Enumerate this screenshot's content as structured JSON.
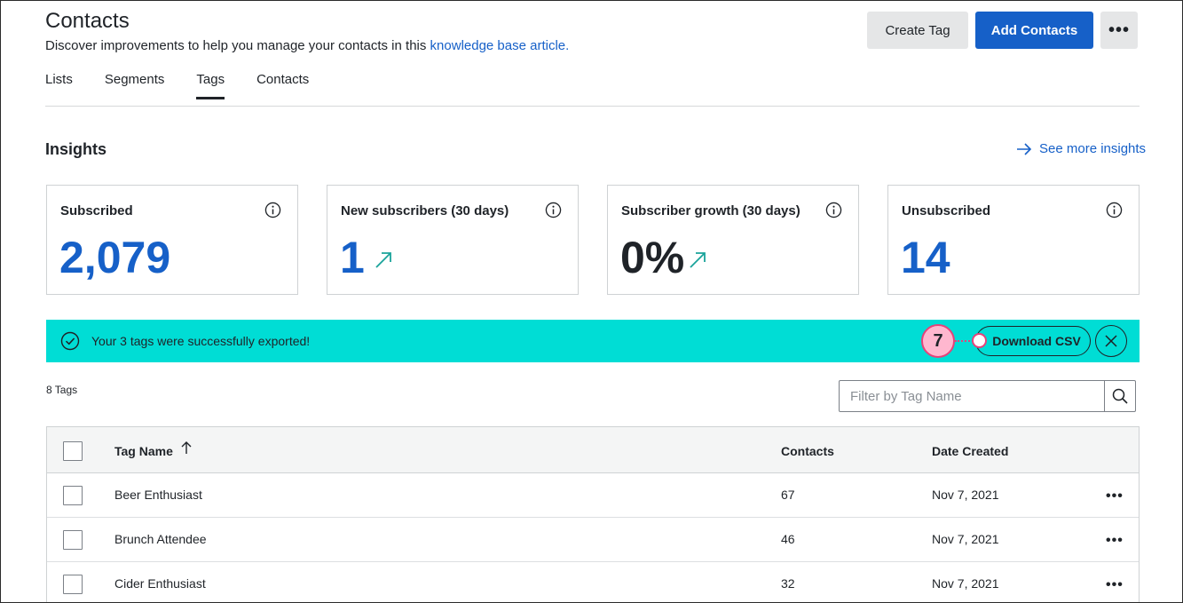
{
  "header": {
    "title": "Contacts",
    "subtitle_text": "Discover improvements to help you manage your contacts in this ",
    "subtitle_link": "knowledge base article.",
    "create_tag_label": "Create Tag",
    "add_contacts_label": "Add Contacts",
    "more_label": "•••"
  },
  "tabs": [
    {
      "label": "Lists",
      "active": false
    },
    {
      "label": "Segments",
      "active": false
    },
    {
      "label": "Tags",
      "active": true
    },
    {
      "label": "Contacts",
      "active": false
    }
  ],
  "insights": {
    "title": "Insights",
    "see_more_label": "See more insights",
    "cards": [
      {
        "title": "Subscribed",
        "value": "2,079",
        "color": "#1660c8",
        "trend": false
      },
      {
        "title": "New subscribers (30 days)",
        "value": "1",
        "color": "#1660c8",
        "trend": true
      },
      {
        "title": "Subscriber growth (30 days)",
        "value": "0%",
        "color": "#1f2328",
        "trend": true
      },
      {
        "title": "Unsubscribed",
        "value": "14",
        "color": "#1660c8",
        "trend": false
      }
    ]
  },
  "banner": {
    "message": "Your 3 tags were successfully exported!",
    "download_label": "Download CSV",
    "step_number": "7",
    "color": "#00ddd5"
  },
  "tags_table": {
    "count_label": "8 Tags",
    "filter_placeholder": "Filter by Tag Name",
    "columns": {
      "name": "Tag Name",
      "contacts": "Contacts",
      "date": "Date Created"
    },
    "rows": [
      {
        "name": "Beer Enthusiast",
        "contacts": "67",
        "date": "Nov 7, 2021"
      },
      {
        "name": "Brunch Attendee",
        "contacts": "46",
        "date": "Nov 7, 2021"
      },
      {
        "name": "Cider Enthusiast",
        "contacts": "32",
        "date": "Nov 7, 2021"
      }
    ],
    "row_menu_label": "•••"
  }
}
